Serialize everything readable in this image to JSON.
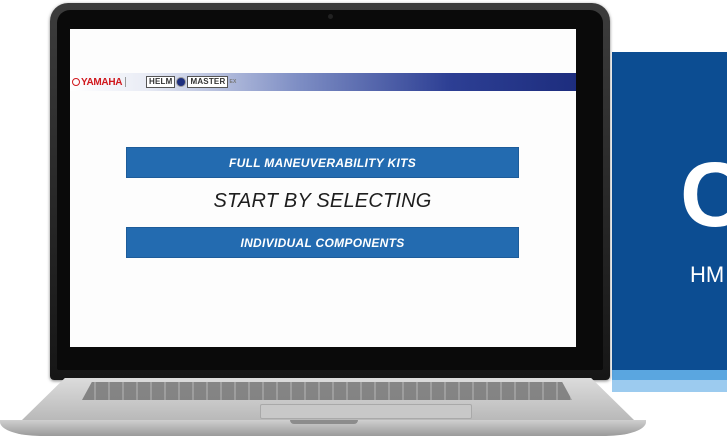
{
  "brand": {
    "yamaha_logo": "YAMAHA",
    "helm_logo_left": "HELM",
    "helm_logo_right": "MASTER",
    "helm_logo_suffix": "EX"
  },
  "screen": {
    "button_kits": "FULL MANEUVERABILITY KITS",
    "prompt": "START BY SELECTING",
    "button_components": "INDIVIDUAL COMPONENTS"
  },
  "promo": {
    "big_text": "C",
    "small_text": "HM"
  },
  "colors": {
    "button_blue": "#236bb0",
    "promo_blue": "#0c4d92",
    "yamaha_red": "#d0181d"
  },
  "icons": [
    "yamaha-logo-icon",
    "helm-master-dot-icon",
    "camera-icon"
  ]
}
